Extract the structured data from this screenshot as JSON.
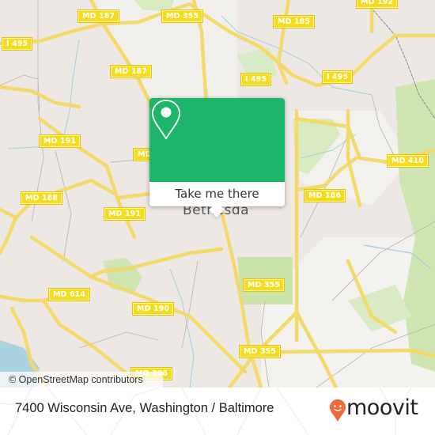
{
  "map": {
    "city_label": "Bethesda",
    "road_shields": [
      {
        "id": "md187-top",
        "label": "MD 187"
      },
      {
        "id": "md355-top",
        "label": "MD 355"
      },
      {
        "id": "md185",
        "label": "MD 185"
      },
      {
        "id": "md192",
        "label": "MD 192"
      },
      {
        "id": "i495-left",
        "label": "I 495"
      },
      {
        "id": "md187-mid",
        "label": "MD 187"
      },
      {
        "id": "i495-mid",
        "label": "I 495"
      },
      {
        "id": "i495-right",
        "label": "I 495"
      },
      {
        "id": "md191-left",
        "label": "MD 191"
      },
      {
        "id": "md-partial",
        "label": "MD"
      },
      {
        "id": "md410",
        "label": "MD 410"
      },
      {
        "id": "md188",
        "label": "MD 188"
      },
      {
        "id": "md191-mid",
        "label": "MD 191"
      },
      {
        "id": "md186",
        "label": "MD 186"
      },
      {
        "id": "md355-mid",
        "label": "MD 355"
      },
      {
        "id": "md614",
        "label": "MD 614"
      },
      {
        "id": "md190",
        "label": "MD 190"
      },
      {
        "id": "md355-bottom",
        "label": "MD 355"
      },
      {
        "id": "md396",
        "label": "MD 396"
      }
    ],
    "attribution": "© OpenStreetMap contributors"
  },
  "popup": {
    "icon": "map-pin-icon",
    "button_label": "Take me there",
    "accent_color": "#1db56a"
  },
  "footer": {
    "address": "7400 Wisconsin Ave, Washington / Baltimore",
    "brand": "moovit",
    "brand_color": "#f26a3c"
  }
}
